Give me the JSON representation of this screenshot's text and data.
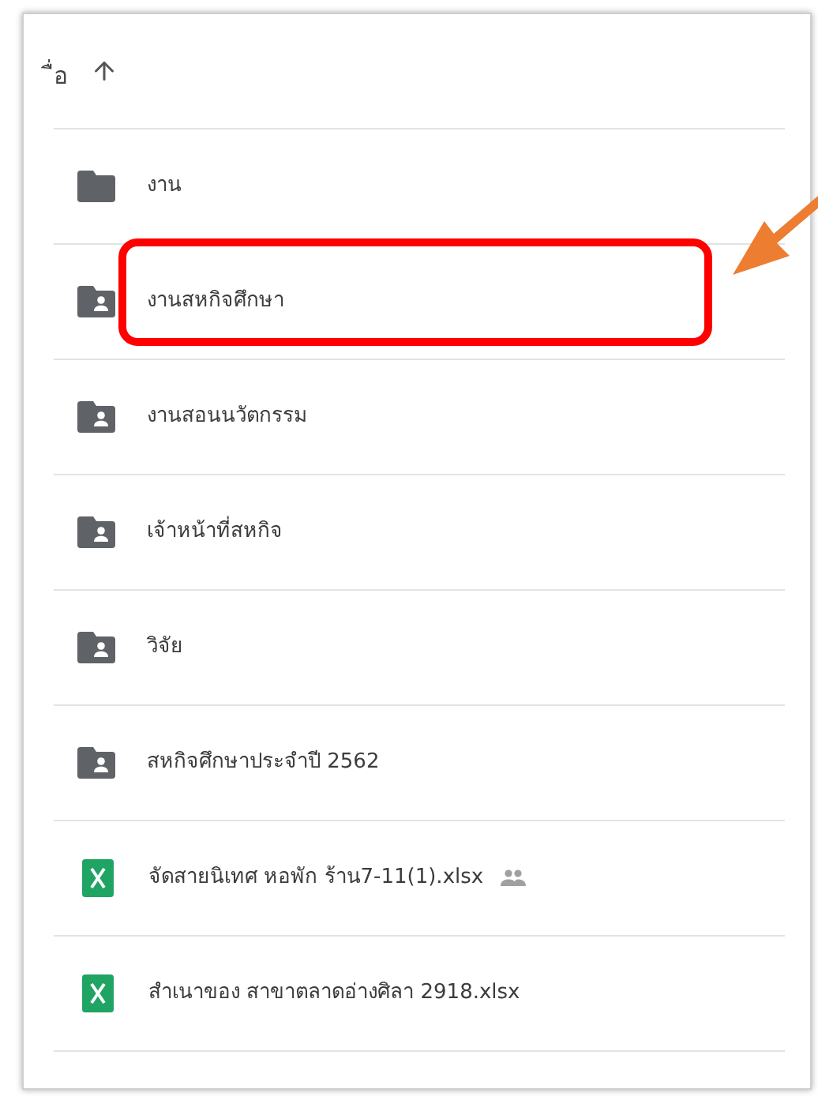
{
  "header": {
    "label": "ื่อ",
    "sort_ascending": true
  },
  "items": [
    {
      "kind": "folder",
      "name": "งาน",
      "shared": false,
      "highlighted": false
    },
    {
      "kind": "shared-folder",
      "name": "งานสหกิจศึกษา",
      "shared": false,
      "highlighted": true
    },
    {
      "kind": "shared-folder",
      "name": "งานสอนนวัตกรรม",
      "shared": false,
      "highlighted": false
    },
    {
      "kind": "shared-folder",
      "name": "เจ้าหน้าที่สหกิจ",
      "shared": false,
      "highlighted": false
    },
    {
      "kind": "shared-folder",
      "name": "วิจัย",
      "shared": false,
      "highlighted": false
    },
    {
      "kind": "shared-folder",
      "name": "สหกิจศึกษาประจำปี 2562",
      "shared": false,
      "highlighted": false
    },
    {
      "kind": "sheet",
      "name": "จัดสายนิเทศ หอพัก ร้าน7-11(1).xlsx",
      "shared": true,
      "highlighted": false
    },
    {
      "kind": "sheet",
      "name": "สำเนาของ สาขาตลาดอ่างศิลา 2918.xlsx",
      "shared": false,
      "highlighted": false
    }
  ]
}
